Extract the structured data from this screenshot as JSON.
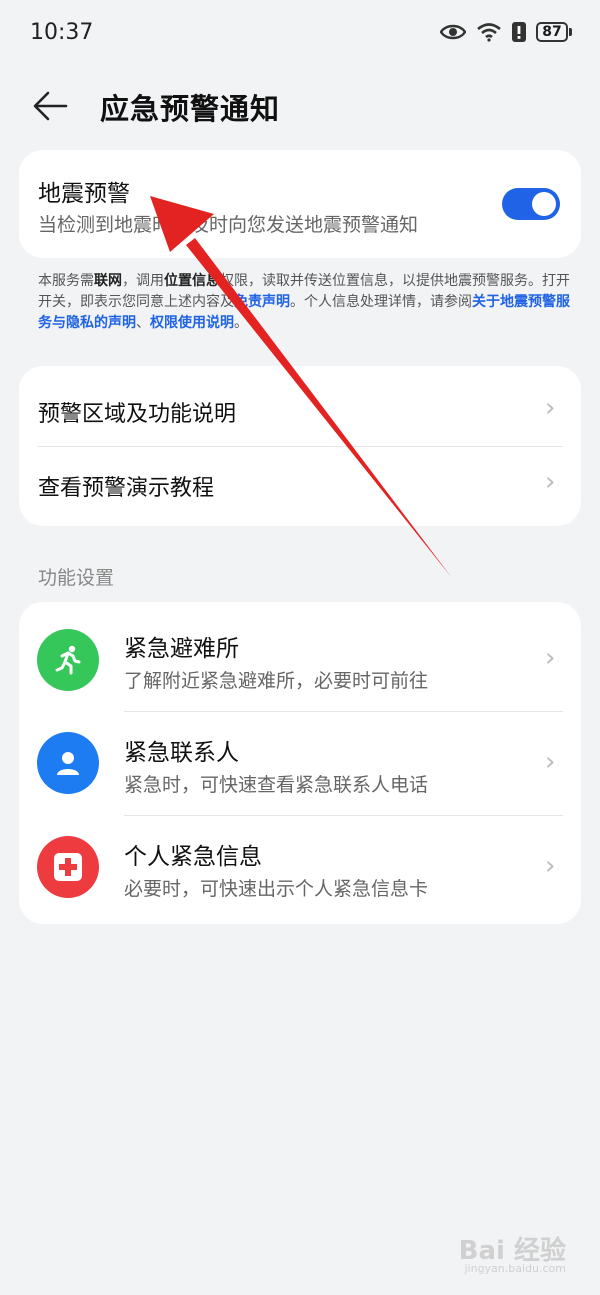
{
  "status_bar": {
    "time": "10:37",
    "battery": "87"
  },
  "header": {
    "title": "应急预警通知"
  },
  "earthquake": {
    "title": "地震预警",
    "subtitle": "当检测到地震时，及时向您发送地震预警通知",
    "toggle_on": true
  },
  "disclaimer": {
    "p1": "本服务需",
    "b1": "联网",
    "p2": "，调用",
    "b2": "位置信息",
    "p3": "权限，读取并传送位置信息，以提供地震预警服务。打开开关，即表示您同意上述内容及",
    "link1": "免责声明",
    "p4": "。个人信息处理详情，请参阅",
    "link2": "关于地震预警服务与隐私的声明",
    "p5": "、",
    "link3": "权限使用说明",
    "p6": "。"
  },
  "info_rows": [
    {
      "label": "预警区域及功能说明"
    },
    {
      "label": "查看预警演示教程"
    }
  ],
  "section_label": "功能设置",
  "settings": [
    {
      "title": "紧急避难所",
      "subtitle": "了解附近紧急避难所，必要时可前往",
      "icon": "running-person-icon",
      "color": "#35c759"
    },
    {
      "title": "紧急联系人",
      "subtitle": "紧急时，可快速查看紧急联系人电话",
      "icon": "contact-person-icon",
      "color": "#1e7cf2"
    },
    {
      "title": "个人紧急信息",
      "subtitle": "必要时，可快速出示个人紧急信息卡",
      "icon": "medical-cross-icon",
      "color": "#ee3b3f"
    }
  ],
  "watermark": {
    "brand": "Bai 经验",
    "url": "jingyan.baidu.com"
  }
}
